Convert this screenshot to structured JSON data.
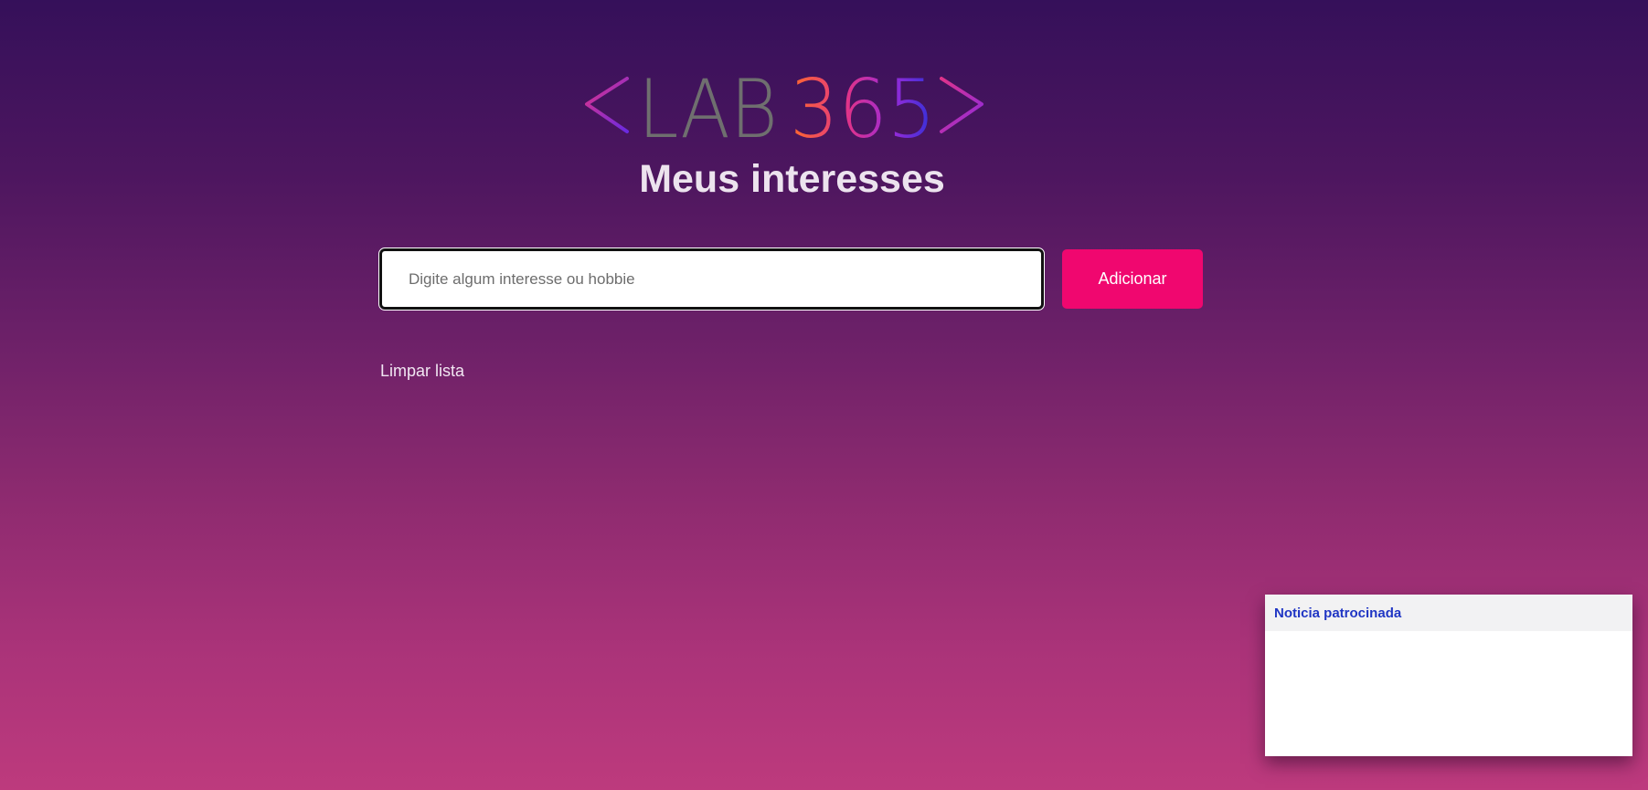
{
  "logo": {
    "text_plain": "LAB",
    "text_colored": "365",
    "colors": {
      "gray": "#6f6f6f",
      "magenta": "#e0338a",
      "orange": "#ff6a2a",
      "blue": "#2a31d8",
      "purple": "#7b2ae0"
    }
  },
  "page": {
    "title": "Meus interesses"
  },
  "search": {
    "placeholder": "Digite algum interesse ou hobbie",
    "value": ""
  },
  "actions": {
    "add_label": "Adicionar",
    "clear_label": "Limpar lista"
  },
  "sponsored": {
    "title": "Noticia patrocinada"
  },
  "colors": {
    "accent": "#f0076f",
    "background_top": "#35105a",
    "background_bottom": "#bd3a7d",
    "sponsored_title": "#2036c4"
  }
}
